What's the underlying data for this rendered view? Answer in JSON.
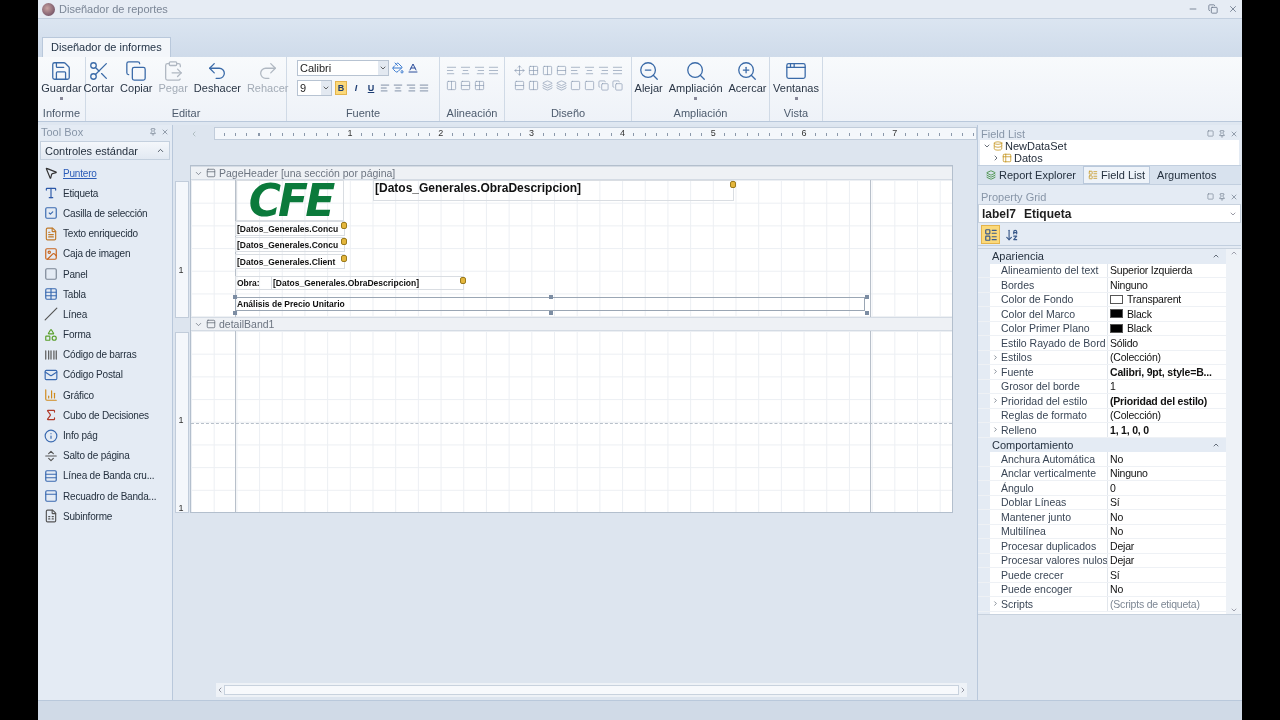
{
  "window": {
    "title": "Diseñador de reportes"
  },
  "ribbon": {
    "tabs": [
      {
        "label": "Diseñador de informes",
        "selected": true
      }
    ],
    "groups": [
      {
        "label": "Informe",
        "kind": "buttons",
        "buttons": [
          {
            "label": "Guardar",
            "disabled": false,
            "dropdown": true
          }
        ]
      },
      {
        "label": "Editar",
        "kind": "buttons",
        "buttons": [
          {
            "label": "Cortar",
            "disabled": false,
            "dropdown": false
          },
          {
            "label": "Copiar",
            "disabled": false,
            "dropdown": false
          },
          {
            "label": "Pegar",
            "disabled": true,
            "dropdown": false
          },
          {
            "label": "Deshacer",
            "disabled": false,
            "dropdown": false
          },
          {
            "label": "Rehacer",
            "disabled": true,
            "dropdown": false
          }
        ]
      },
      {
        "label": "Fuente",
        "kind": "font",
        "font_name": "Calibri",
        "font_size": "9",
        "styles": [
          {
            "label": "B",
            "on": true
          },
          {
            "label": "I",
            "on": false
          },
          {
            "label": "U",
            "on": false
          }
        ]
      },
      {
        "label": "Alineación",
        "kind": "icons"
      },
      {
        "label": "Diseño",
        "kind": "icons"
      },
      {
        "label": "Ampliación",
        "kind": "buttons",
        "buttons": [
          {
            "label": "Alejar",
            "disabled": false,
            "dropdown": false
          },
          {
            "label": "Ampliación",
            "disabled": false,
            "dropdown": true
          },
          {
            "label": "Acercar",
            "disabled": false,
            "dropdown": false
          }
        ]
      },
      {
        "label": "Vista",
        "kind": "buttons",
        "buttons": [
          {
            "label": "Ventanas",
            "disabled": false,
            "dropdown": true
          }
        ]
      }
    ]
  },
  "toolbox": {
    "title": "Tool Box",
    "section": "Controles estándar",
    "items": [
      {
        "kind": "pointer",
        "label": "Puntero",
        "selected": true
      },
      {
        "kind": "label",
        "label": "Etiqueta",
        "selected": false
      },
      {
        "kind": "checkbox",
        "label": "Casilla de selección",
        "selected": false
      },
      {
        "kind": "richtext",
        "label": "Texto enriquecido",
        "selected": false
      },
      {
        "kind": "image",
        "label": "Caja de imagen",
        "selected": false
      },
      {
        "kind": "panel",
        "label": "Panel",
        "selected": false
      },
      {
        "kind": "table",
        "label": "Tabla",
        "selected": false
      },
      {
        "kind": "line",
        "label": "Línea",
        "selected": false
      },
      {
        "kind": "shape",
        "label": "Forma",
        "selected": false
      },
      {
        "kind": "barcode",
        "label": "Código de barras",
        "selected": false
      },
      {
        "kind": "zipcode",
        "label": "Código Postal",
        "selected": false
      },
      {
        "kind": "chart",
        "label": "Gráfico",
        "selected": false
      },
      {
        "kind": "cube",
        "label": "Cubo de Decisiones",
        "selected": false
      },
      {
        "kind": "pageinfo",
        "label": "Info pág",
        "selected": false
      },
      {
        "kind": "pagebreak",
        "label": "Salto de página",
        "selected": false
      },
      {
        "kind": "crossline",
        "label": "Línea de Banda cru...",
        "selected": false
      },
      {
        "kind": "crossbox",
        "label": "Recuadro de Banda...",
        "selected": false
      },
      {
        "kind": "subreport",
        "label": "Subinforme",
        "selected": false
      }
    ]
  },
  "designer": {
    "ruler_marks": [
      "1",
      "2",
      "3",
      "4",
      "5",
      "6",
      "7"
    ],
    "bands": [
      {
        "title": "PageHeader [una sección por página]",
        "expanded": true,
        "ruler_marks": [
          "1"
        ],
        "controls": [
          {
            "kind": "logo",
            "text": "CFE",
            "bound": false,
            "selected": false
          },
          {
            "kind": "title",
            "text": "[Datos_Generales.ObraDescripcion]",
            "bound": true,
            "selected": false
          },
          {
            "kind": "label",
            "text": "[Datos_Generales.Concu",
            "bound": true,
            "selected": false
          },
          {
            "kind": "label",
            "text": "[Datos_Generales.Concu",
            "bound": true,
            "selected": false
          },
          {
            "kind": "label",
            "text": "[Datos_Generales.Client",
            "bound": true,
            "selected": false
          },
          {
            "kind": "label",
            "text": "Obra:",
            "bound": false,
            "selected": false
          },
          {
            "kind": "label",
            "text": "[Datos_Generales.ObraDescripcion]",
            "bound": true,
            "selected": false
          },
          {
            "kind": "label",
            "text": "Análisis de Precio Unitario",
            "bound": false,
            "selected": true
          }
        ]
      },
      {
        "title": "detailBand1",
        "expanded": true,
        "ruler_marks": [
          "1",
          "1"
        ]
      }
    ]
  },
  "field_list": {
    "title": "Field List",
    "tree": [
      {
        "label": "NewDataSet",
        "expanded": true,
        "children": [
          {
            "label": "Datos",
            "expanded": false
          }
        ]
      }
    ],
    "tabs": [
      {
        "label": "Report Explorer",
        "selected": false
      },
      {
        "label": "Field List",
        "selected": true
      },
      {
        "label": "Argumentos",
        "selected": false
      }
    ]
  },
  "property_grid": {
    "title": "Property Grid",
    "object_name": "label7",
    "object_type": "Etiqueta",
    "views": [
      {
        "kind": "categorized",
        "selected": true
      },
      {
        "kind": "alphabetical",
        "selected": false
      }
    ],
    "categories": [
      {
        "name": "Apariencia",
        "expanded": true,
        "rows": [
          {
            "name": "Alineamiento del text",
            "value": "Superior Izquierda"
          },
          {
            "name": "Bordes",
            "value": "Ninguno"
          },
          {
            "name": "Color de Fondo",
            "value": "Transparent",
            "color": "#ffffff"
          },
          {
            "name": "Color del Marco",
            "value": "Black",
            "color": "#000000"
          },
          {
            "name": "Color Primer Plano",
            "value": "Black",
            "color": "#000000"
          },
          {
            "name": "Estilo Rayado de Bord",
            "value": "Sólido"
          },
          {
            "name": "Estilos",
            "value": "(Colección)",
            "expandable": true
          },
          {
            "name": "Fuente",
            "value": "Calibri, 9pt, style=B...",
            "expandable": true,
            "bold": true
          },
          {
            "name": "Grosor del borde",
            "value": "1"
          },
          {
            "name": "Prioridad del estilo",
            "value": "(Prioridad del estilo)",
            "expandable": true,
            "bold": true
          },
          {
            "name": "Reglas de formato",
            "value": "(Colección)"
          },
          {
            "name": "Relleno",
            "value": "1, 1, 0, 0",
            "expandable": true,
            "bold": true
          }
        ]
      },
      {
        "name": "Comportamiento",
        "expanded": true,
        "rows": [
          {
            "name": "Anchura Automática",
            "value": "No"
          },
          {
            "name": "Anclar verticalmente",
            "value": "Ninguno"
          },
          {
            "name": "Ángulo",
            "value": "0"
          },
          {
            "name": "Doblar Líneas",
            "value": "Sí"
          },
          {
            "name": "Mantener junto",
            "value": "No"
          },
          {
            "name": "Multilínea",
            "value": "No"
          },
          {
            "name": "Procesar duplicados",
            "value": "Dejar"
          },
          {
            "name": "Procesar valores nulos",
            "value": "Dejar"
          },
          {
            "name": "Puede crecer",
            "value": "Sí"
          },
          {
            "name": "Puede encoger",
            "value": "No"
          },
          {
            "name": "Scripts",
            "value": "(Scripts de etiqueta)",
            "expandable": true,
            "muted": true
          }
        ]
      }
    ]
  }
}
